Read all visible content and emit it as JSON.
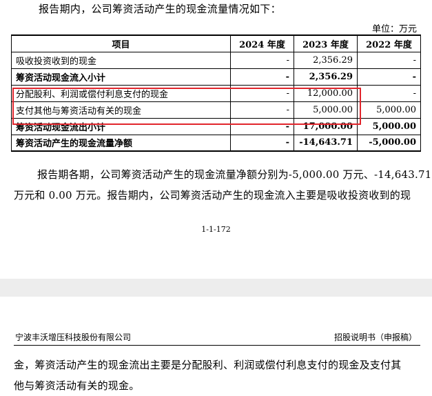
{
  "page1": {
    "intro": "报告期内，公司筹资活动产生的现金流量情况如下：",
    "unit": "单位：万元",
    "table": {
      "headers": [
        "项目",
        "2024 年度",
        "2023 年度",
        "2022 年度"
      ],
      "rows": [
        {
          "cells": [
            "吸收投资收到的现金",
            "-",
            "2,356.29",
            "-"
          ],
          "bold": false
        },
        {
          "cells": [
            "筹资活动现金流入小计",
            "-",
            "2,356.29",
            "-"
          ],
          "bold": true
        },
        {
          "cells": [
            "分配股利、利润或偿付利息支付的现金",
            "-",
            "12,000.00",
            "-"
          ],
          "bold": false
        },
        {
          "cells": [
            "支付其他与筹资活动有关的现金",
            "-",
            "5,000.00",
            "5,000.00"
          ],
          "bold": false
        },
        {
          "cells": [
            "筹资活动现金流出小计",
            "-",
            "17,000.00",
            "5,000.00"
          ],
          "bold": true
        },
        {
          "cells": [
            "筹资活动产生的现金流量净额",
            "-",
            "-14,643.71",
            "-5,000.00"
          ],
          "bold": true
        }
      ]
    },
    "highlight_color": "#e1242b",
    "para_line1": "报告期各期，公司筹资活动产生的现金流量净额分别为-5,000.00 万元、-14,643.71",
    "para_line2": "万元和 0.00 万元。报告期内，公司筹资活动产生的现金流入主要是吸收投资收到的现",
    "page_number": "1-1-172"
  },
  "page2": {
    "header_left": "宁波丰沃增压科技股份有限公司",
    "header_right": "招股说明书（申报稿）",
    "para_line1": "金，筹资活动产生的现金流出主要是分配股利、利润或偿付利息支付的现金及支付其",
    "para_line2": "他与筹资活动有关的现金。"
  }
}
